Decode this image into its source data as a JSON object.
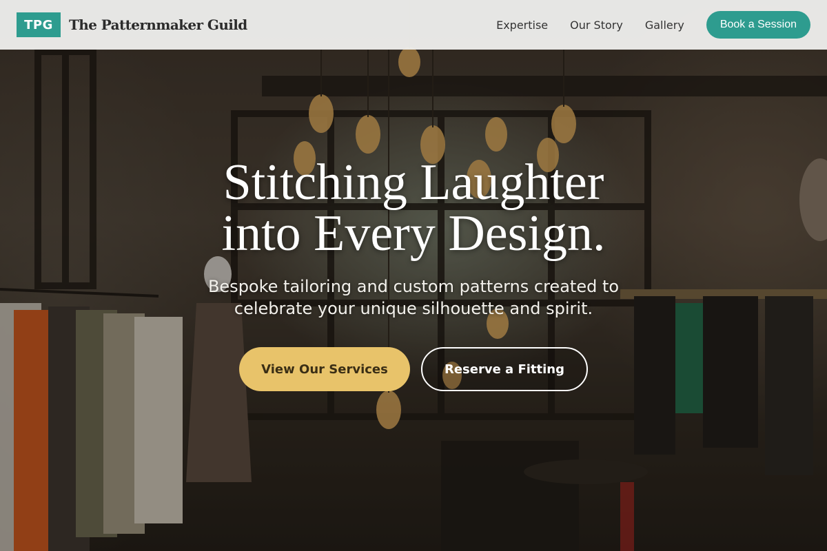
{
  "brand": {
    "mark": "TPG",
    "name": "The Patternmaker Guild",
    "accent_color": "#2e9c8f"
  },
  "nav": {
    "links": [
      {
        "label": "Expertise"
      },
      {
        "label": "Our Story"
      },
      {
        "label": "Gallery"
      }
    ],
    "cta_label": "Book a Session"
  },
  "hero": {
    "title_line1": "Stitching Laughter",
    "title_line2": "into Every Design.",
    "subtitle": "Bespoke tailoring and custom patterns created to celebrate your unique silhouette and spirit.",
    "primary_button": "View Our Services",
    "secondary_button": "Reserve a Fitting",
    "primary_color": "#e8c36a"
  }
}
